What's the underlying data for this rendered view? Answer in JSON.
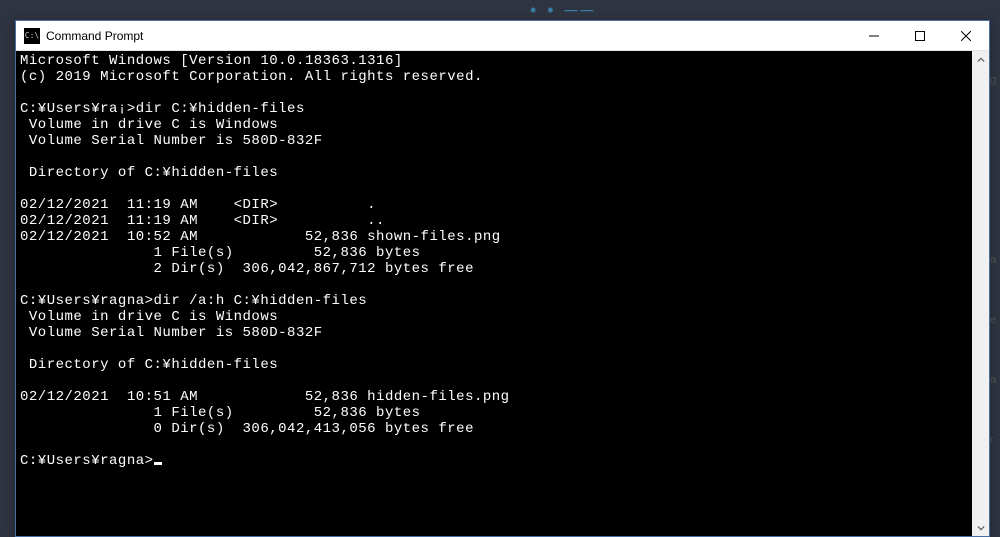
{
  "window": {
    "title": "Command Prompt"
  },
  "bg_text": "• • ──",
  "terminal": {
    "lines": [
      "Microsoft Windows [Version 10.0.18363.1316]",
      "(c) 2019 Microsoft Corporation. All rights reserved.",
      "",
      "C:¥Users¥ra¡>dir C:¥hidden-files",
      " Volume in drive C is Windows",
      " Volume Serial Number is 580D-832F",
      "",
      " Directory of C:¥hidden-files",
      "",
      "02/12/2021  11:19 AM    <DIR>          .",
      "02/12/2021  11:19 AM    <DIR>          ..",
      "02/12/2021  10:52 AM            52,836 shown-files.png",
      "               1 File(s)         52,836 bytes",
      "               2 Dir(s)  306,042,867,712 bytes free",
      "",
      "C:¥Users¥ragna>dir /a:h C:¥hidden-files",
      " Volume in drive C is Windows",
      " Volume Serial Number is 580D-832F",
      "",
      " Directory of C:¥hidden-files",
      "",
      "02/12/2021  10:51 AM            52,836 hidden-files.png",
      "               1 File(s)         52,836 bytes",
      "               0 Dir(s)  306,042,413,056 bytes free",
      ""
    ],
    "prompt": "C:¥Users¥ragna>"
  },
  "side": {
    "c1": "g",
    "c2": "a",
    "c3": "e",
    "c4": "a",
    "c5": "r"
  }
}
